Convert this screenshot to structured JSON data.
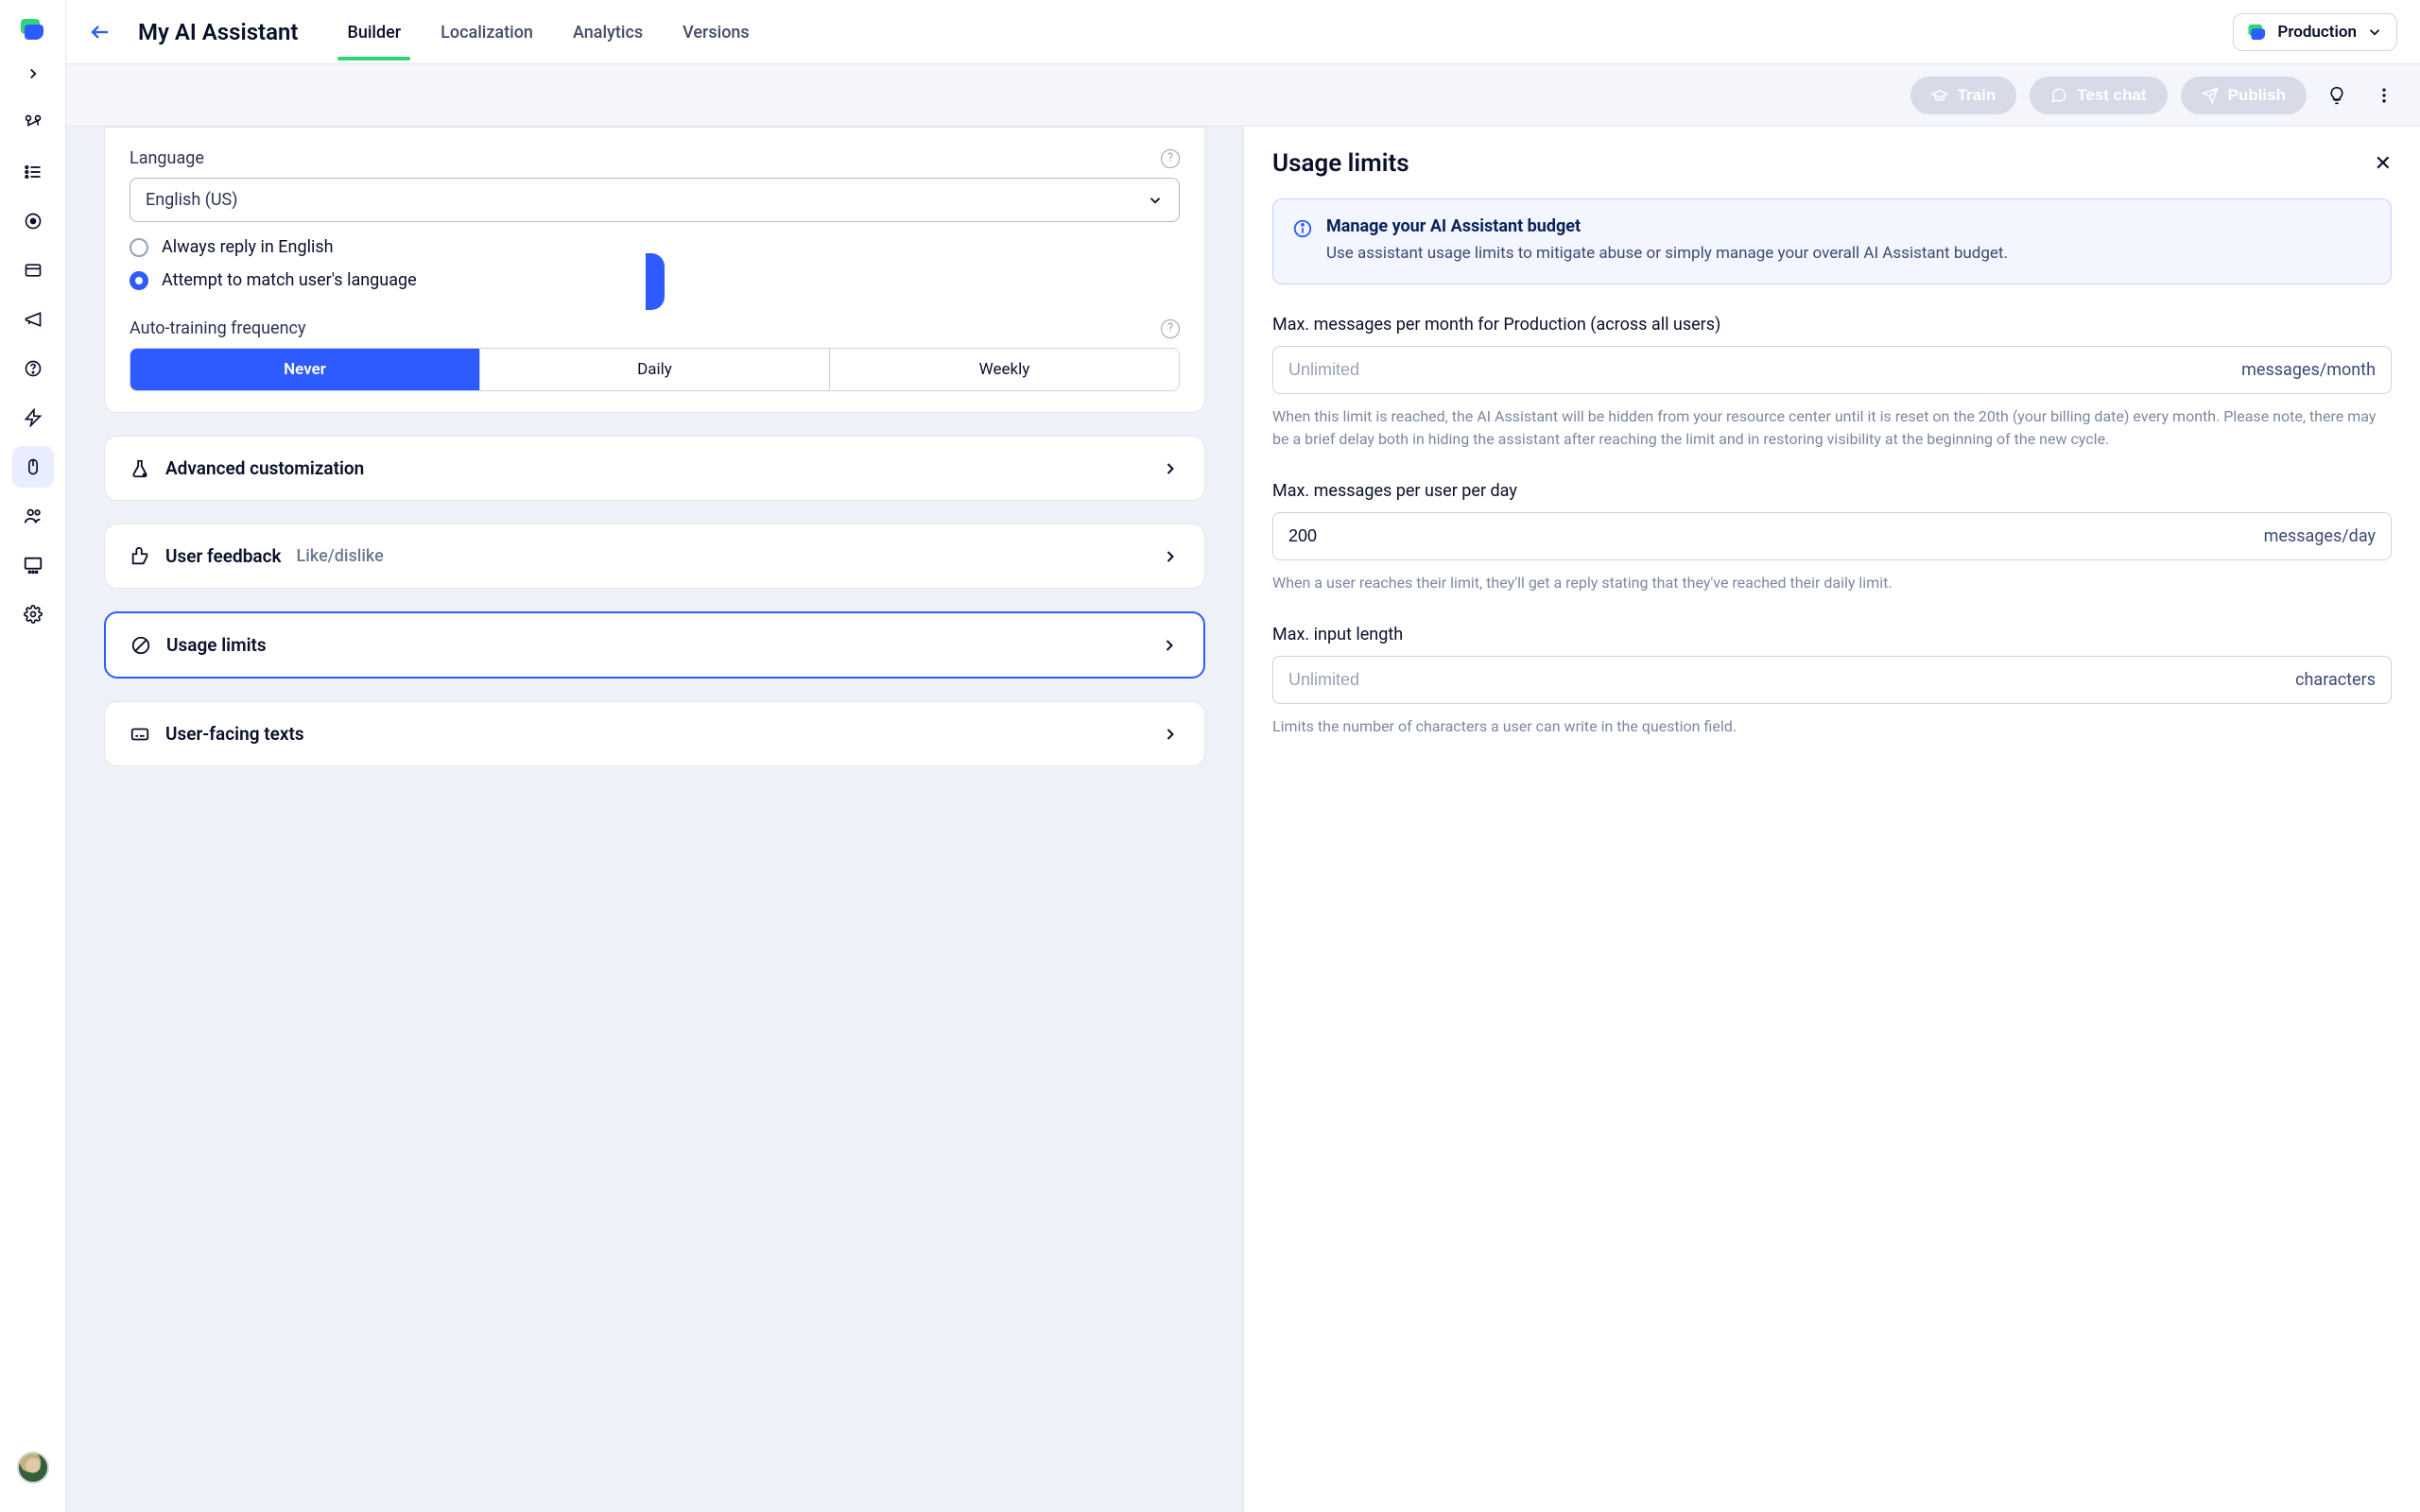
{
  "header": {
    "title": "My AI Assistant",
    "tabs": [
      "Builder",
      "Localization",
      "Analytics",
      "Versions"
    ],
    "active_tab": 0,
    "env_label": "Production"
  },
  "actions": {
    "train": "Train",
    "test_chat": "Test chat",
    "publish": "Publish"
  },
  "settings": {
    "language": {
      "label": "Language",
      "selected": "English (US)",
      "radio1": "Always reply in English",
      "radio2": "Attempt to match user's language",
      "checked_index": 1
    },
    "auto_training": {
      "label": "Auto-training frequency",
      "options": [
        "Never",
        "Daily",
        "Weekly"
      ],
      "active_index": 0
    },
    "rows": {
      "advanced": "Advanced customization",
      "feedback": "User feedback",
      "feedback_sub": "Like/dislike",
      "usage_limits": "Usage limits",
      "user_texts": "User-facing texts"
    }
  },
  "right_panel": {
    "title": "Usage limits",
    "info_title": "Manage your AI Assistant budget",
    "info_desc": "Use assistant usage limits to mitigate abuse or simply manage your overall AI Assistant budget.",
    "fields": {
      "monthly": {
        "label": "Max. messages per month for Production (across all users)",
        "placeholder": "Unlimited",
        "value": "",
        "suffix": "messages/month",
        "help": "When this limit is reached, the AI Assistant will be hidden from your resource center until it is reset on the 20th (your billing date) every month. Please note, there may be a brief delay both in hiding the assistant after reaching the limit and in restoring visibility at the beginning of the new cycle."
      },
      "daily": {
        "label": "Max. messages per user per day",
        "placeholder": "",
        "value": "200",
        "suffix": "messages/day",
        "help": "When a user reaches their limit, they'll get a reply stating that they've reached their daily limit."
      },
      "input_len": {
        "label": "Max. input length",
        "placeholder": "Unlimited",
        "value": "",
        "suffix": "characters",
        "help": "Limits the number of characters a user can write in the question field."
      }
    }
  }
}
